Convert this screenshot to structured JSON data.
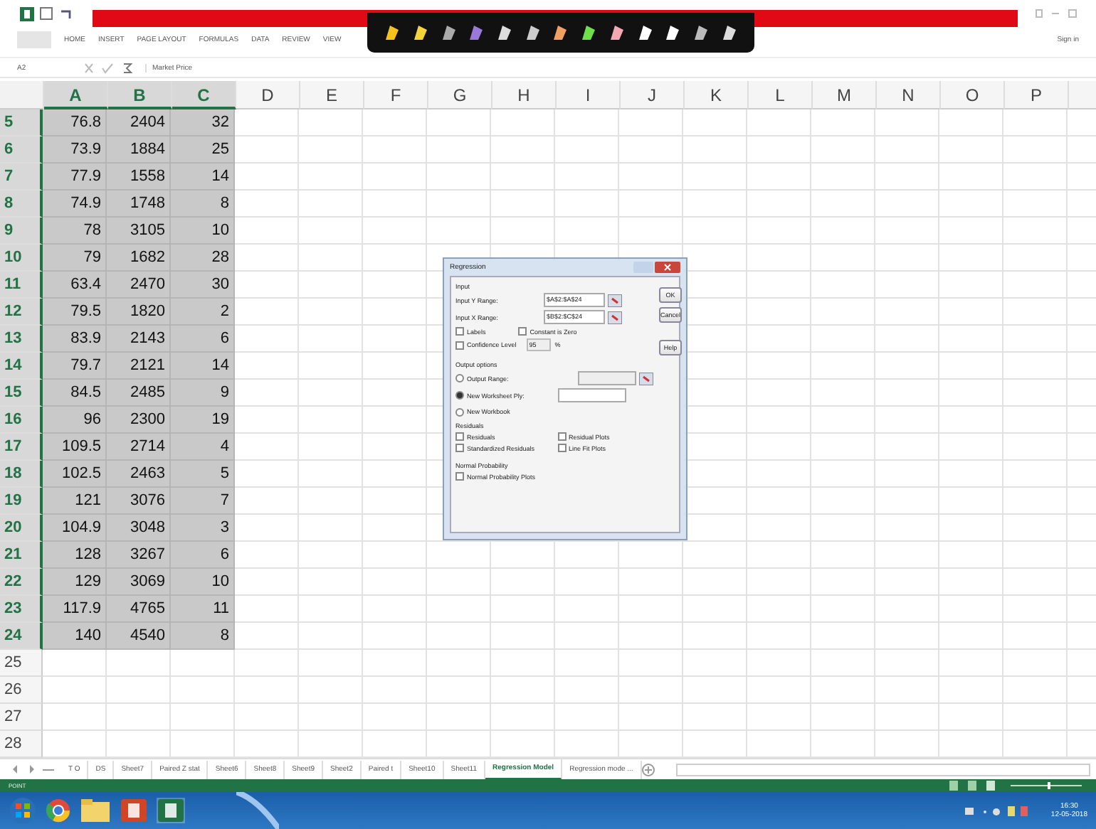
{
  "ribbon": {
    "tabs": [
      "HOME",
      "INSERT",
      "PAGE LAYOUT",
      "FORMULAS",
      "DATA",
      "REVIEW",
      "VIEW"
    ],
    "sign_in": "Sign in"
  },
  "formula_bar": {
    "name_box": "A2",
    "formula": "Market Price"
  },
  "columns": [
    {
      "label": "A",
      "selected": true
    },
    {
      "label": "B",
      "selected": true
    },
    {
      "label": "C",
      "selected": true
    },
    {
      "label": "D",
      "selected": false
    },
    {
      "label": "E",
      "selected": false
    },
    {
      "label": "F",
      "selected": false
    },
    {
      "label": "G",
      "selected": false
    },
    {
      "label": "H",
      "selected": false
    },
    {
      "label": "I",
      "selected": false
    },
    {
      "label": "J",
      "selected": false
    },
    {
      "label": "K",
      "selected": false
    },
    {
      "label": "L",
      "selected": false
    },
    {
      "label": "M",
      "selected": false
    },
    {
      "label": "N",
      "selected": false
    },
    {
      "label": "O",
      "selected": false
    },
    {
      "label": "P",
      "selected": false
    }
  ],
  "rows": [
    {
      "number": "5",
      "selected": true,
      "cells": [
        "76.8",
        "2404",
        "32"
      ]
    },
    {
      "number": "6",
      "selected": true,
      "cells": [
        "73.9",
        "1884",
        "25"
      ]
    },
    {
      "number": "7",
      "selected": true,
      "cells": [
        "77.9",
        "1558",
        "14"
      ]
    },
    {
      "number": "8",
      "selected": true,
      "cells": [
        "74.9",
        "1748",
        "8"
      ]
    },
    {
      "number": "9",
      "selected": true,
      "cells": [
        "78",
        "3105",
        "10"
      ]
    },
    {
      "number": "10",
      "selected": true,
      "cells": [
        "79",
        "1682",
        "28"
      ]
    },
    {
      "number": "11",
      "selected": true,
      "cells": [
        "63.4",
        "2470",
        "30"
      ]
    },
    {
      "number": "12",
      "selected": true,
      "cells": [
        "79.5",
        "1820",
        "2"
      ]
    },
    {
      "number": "13",
      "selected": true,
      "cells": [
        "83.9",
        "2143",
        "6"
      ]
    },
    {
      "number": "14",
      "selected": true,
      "cells": [
        "79.7",
        "2121",
        "14"
      ]
    },
    {
      "number": "15",
      "selected": true,
      "cells": [
        "84.5",
        "2485",
        "9"
      ]
    },
    {
      "number": "16",
      "selected": true,
      "cells": [
        "96",
        "2300",
        "19"
      ]
    },
    {
      "number": "17",
      "selected": true,
      "cells": [
        "109.5",
        "2714",
        "4"
      ]
    },
    {
      "number": "18",
      "selected": true,
      "cells": [
        "102.5",
        "2463",
        "5"
      ]
    },
    {
      "number": "19",
      "selected": true,
      "cells": [
        "121",
        "3076",
        "7"
      ]
    },
    {
      "number": "20",
      "selected": true,
      "cells": [
        "104.9",
        "3048",
        "3"
      ]
    },
    {
      "number": "21",
      "selected": true,
      "cells": [
        "128",
        "3267",
        "6"
      ]
    },
    {
      "number": "22",
      "selected": true,
      "cells": [
        "129",
        "3069",
        "10"
      ]
    },
    {
      "number": "23",
      "selected": true,
      "cells": [
        "117.9",
        "4765",
        "11"
      ]
    },
    {
      "number": "24",
      "selected": true,
      "cells": [
        "140",
        "4540",
        "8"
      ]
    },
    {
      "number": "25",
      "selected": false,
      "cells": []
    },
    {
      "number": "26",
      "selected": false,
      "cells": []
    },
    {
      "number": "27",
      "selected": false,
      "cells": []
    },
    {
      "number": "28",
      "selected": false,
      "cells": []
    }
  ],
  "dialog": {
    "title": "Regression",
    "input_heading": "Input",
    "fields": [
      {
        "label": "Input Y Range:",
        "value": "$A$2:$A$24"
      },
      {
        "label": "Input X Range:",
        "value": "$B$2:$C$24"
      }
    ],
    "labels_checkbox": {
      "label": "Labels",
      "checked": false
    },
    "constant_checkbox": {
      "label": "Constant is Zero",
      "checked": false
    },
    "confidence": {
      "label": "Confidence Level",
      "checked": false,
      "value": "95",
      "unit": "%"
    },
    "output_heading": "Output options",
    "output_options": [
      {
        "label": "Output Range:",
        "selected": false,
        "kind": "range"
      },
      {
        "label": "New Worksheet Ply:",
        "selected": true,
        "kind": "text"
      },
      {
        "label": "New Workbook",
        "selected": false,
        "kind": "none"
      }
    ],
    "residuals_heading": "Residuals",
    "residuals": [
      {
        "label": "Residuals",
        "checked": false
      },
      {
        "label": "Residual Plots",
        "checked": false
      },
      {
        "label": "Standardized Residuals",
        "checked": false
      },
      {
        "label": "Line Fit Plots",
        "checked": false
      }
    ],
    "normal_heading": "Normal Probability",
    "normal": [
      {
        "label": "Normal Probability Plots",
        "checked": false
      }
    ],
    "buttons": [
      "OK",
      "Cancel",
      "Help"
    ]
  },
  "sheet_tabs": [
    {
      "label": "T O",
      "selected": false
    },
    {
      "label": "DS",
      "selected": false
    },
    {
      "label": "Sheet7",
      "selected": false
    },
    {
      "label": "Paired Z stat",
      "selected": false
    },
    {
      "label": "Sheet6",
      "selected": false
    },
    {
      "label": "Sheet8",
      "selected": false
    },
    {
      "label": "Sheet9",
      "selected": false
    },
    {
      "label": "Sheet2",
      "selected": false
    },
    {
      "label": "Paired t",
      "selected": false
    },
    {
      "label": "Sheet10",
      "selected": false
    },
    {
      "label": "Sheet11",
      "selected": false
    },
    {
      "label": "Regression Model",
      "selected": true
    },
    {
      "label": "Regression mode ...",
      "selected": false
    }
  ],
  "status_bar": {
    "mode": "POINT",
    "zoom": {
      "level": 0.55
    }
  },
  "taskbar": {
    "time": "16:30",
    "date": "12-05-2018"
  }
}
